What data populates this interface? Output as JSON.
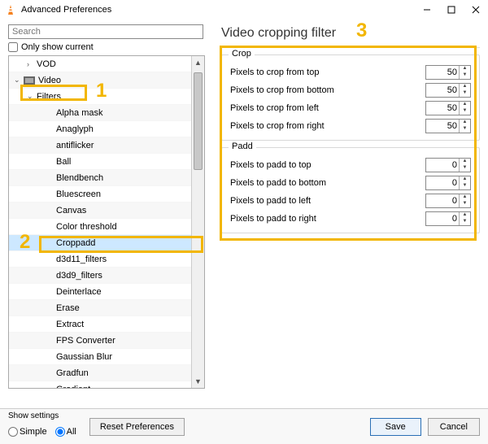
{
  "titlebar": {
    "title": "Advanced Preferences"
  },
  "search": {
    "placeholder": "Search"
  },
  "only_current_label": "Only show current",
  "tree": {
    "items": [
      {
        "label": "VOD",
        "arrow": "›",
        "indent": 1
      },
      {
        "label": "Video",
        "arrow": "⌄",
        "indent": 0,
        "icon": "video"
      },
      {
        "label": "Filters",
        "arrow": "⌄",
        "indent": 1,
        "highlight": "box1"
      },
      {
        "label": "Alpha mask",
        "indent": 3
      },
      {
        "label": "Anaglyph",
        "indent": 3
      },
      {
        "label": "antiflicker",
        "indent": 3
      },
      {
        "label": "Ball",
        "indent": 3
      },
      {
        "label": "Blendbench",
        "indent": 3
      },
      {
        "label": "Bluescreen",
        "indent": 3
      },
      {
        "label": "Canvas",
        "indent": 3
      },
      {
        "label": "Color threshold",
        "indent": 3
      },
      {
        "label": "Croppadd",
        "indent": 3,
        "selected": true,
        "highlight": "box2"
      },
      {
        "label": "d3d11_filters",
        "indent": 3
      },
      {
        "label": "d3d9_filters",
        "indent": 3
      },
      {
        "label": "Deinterlace",
        "indent": 3
      },
      {
        "label": "Erase",
        "indent": 3
      },
      {
        "label": "Extract",
        "indent": 3
      },
      {
        "label": "FPS Converter",
        "indent": 3
      },
      {
        "label": "Gaussian Blur",
        "indent": 3
      },
      {
        "label": "Gradfun",
        "indent": 3
      },
      {
        "label": "Gradient",
        "indent": 3
      }
    ]
  },
  "panel": {
    "title": "Video cropping filter",
    "groups": [
      {
        "legend": "Crop",
        "fields": [
          {
            "label": "Pixels to crop from top",
            "value": 50
          },
          {
            "label": "Pixels to crop from bottom",
            "value": 50
          },
          {
            "label": "Pixels to crop from left",
            "value": 50
          },
          {
            "label": "Pixels to crop from right",
            "value": 50
          }
        ]
      },
      {
        "legend": "Padd",
        "fields": [
          {
            "label": "Pixels to padd to top",
            "value": 0
          },
          {
            "label": "Pixels to padd to bottom",
            "value": 0
          },
          {
            "label": "Pixels to padd to left",
            "value": 0
          },
          {
            "label": "Pixels to padd to right",
            "value": 0
          }
        ]
      }
    ]
  },
  "footer": {
    "show_settings_label": "Show settings",
    "radio_simple": "Simple",
    "radio_all": "All",
    "reset": "Reset Preferences",
    "save": "Save",
    "cancel": "Cancel"
  },
  "annotations": {
    "n1": "1",
    "n2": "2",
    "n3": "3"
  }
}
